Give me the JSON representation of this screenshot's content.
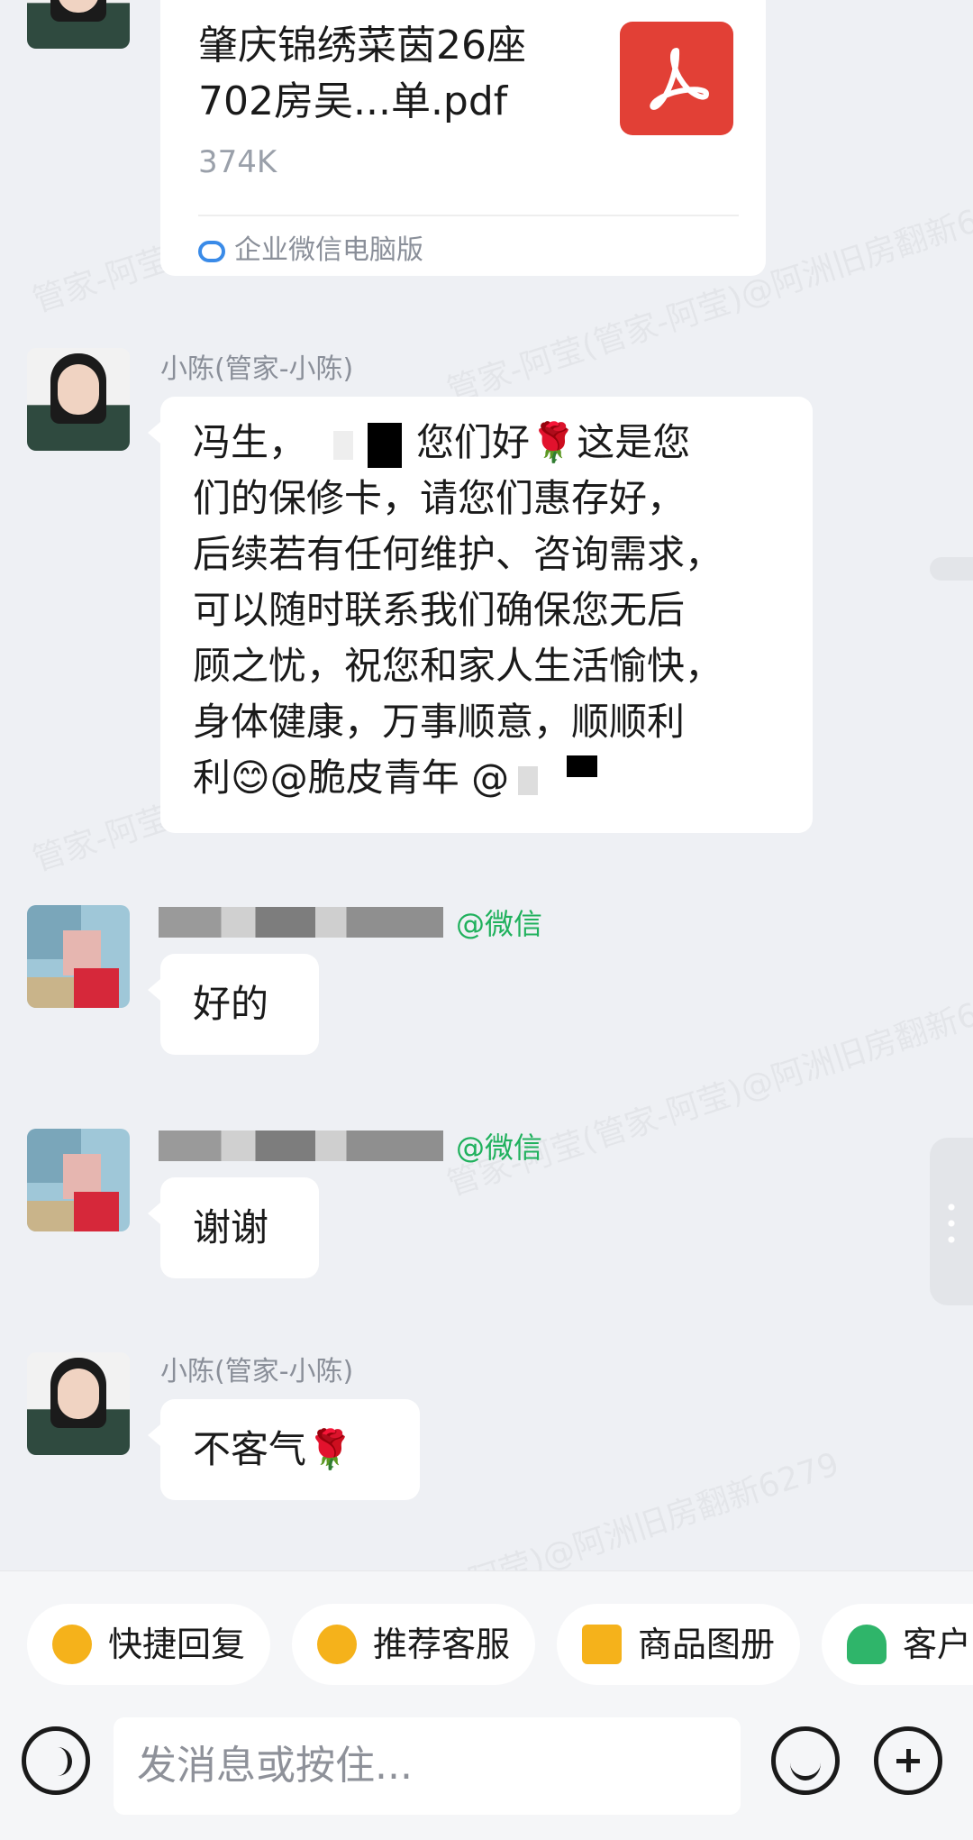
{
  "watermark": "管家-阿莹(管家-阿莹)@阿洲旧房翻新6279",
  "file_message": {
    "filename_line1": "肇庆锦绣菜茵26座",
    "filename_line2": "702房吴...单.pdf",
    "size": "374K",
    "source": "企业微信电脑版",
    "icon": "pdf-icon",
    "icon_color": "#e24036"
  },
  "messages": [
    {
      "sender": "小陈(管家-小陈)",
      "lines": [
        "冯生，",
        "您们好🌹这是您",
        "们的保修卡，请您们惠存好，",
        "后续若有任何维护、咨询需求，",
        "可以随时联系我们确保您无后",
        "顾之忧，祝您和家人生活愉快，",
        "身体健康，万事顺意，顺顺利",
        "利😊@脆皮青年 @"
      ]
    },
    {
      "tag": "@微信",
      "text": "好的"
    },
    {
      "tag": "@微信",
      "text": "谢谢"
    },
    {
      "sender": "小陈(管家-小陈)",
      "text": "不客气🌹"
    }
  ],
  "quick_actions": [
    {
      "label": "快捷回复",
      "icon": "quick-reply-icon",
      "color": "#f5b21b"
    },
    {
      "label": "推荐客服",
      "icon": "recommend-service-icon",
      "color": "#f5b21b"
    },
    {
      "label": "商品图册",
      "icon": "product-album-icon",
      "color": "#f5b21b"
    },
    {
      "label": "客户",
      "icon": "customer-icon",
      "color": "#2fb56a"
    }
  ],
  "input": {
    "placeholder": "发消息或按住..."
  },
  "colors": {
    "tag_green": "#20b15d",
    "background": "#eef0f4",
    "bubble": "#ffffff"
  }
}
